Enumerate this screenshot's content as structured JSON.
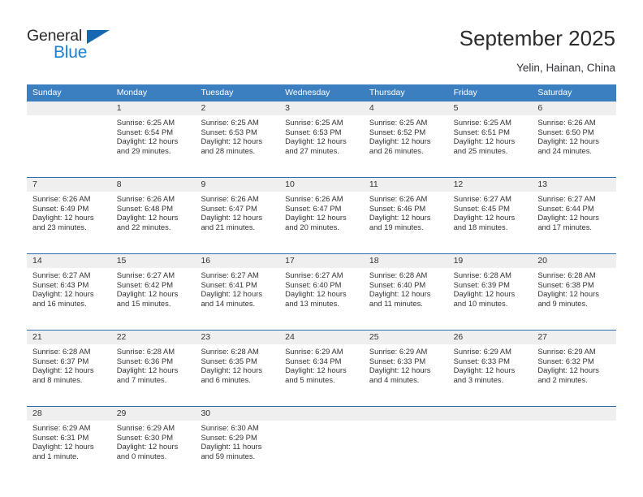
{
  "brand": {
    "name_part1": "General",
    "name_part2": "Blue",
    "triangle_color": "#1667b1",
    "blue_color": "#1f7fd0"
  },
  "header": {
    "title": "September 2025",
    "subtitle": "Yelin, Hainan, China"
  },
  "theme": {
    "header_bg": "#3c7fc1",
    "row_divider": "#2f6daf",
    "daynum_bg": "#efefef",
    "text": "#333333"
  },
  "weekdays": [
    "Sunday",
    "Monday",
    "Tuesday",
    "Wednesday",
    "Thursday",
    "Friday",
    "Saturday"
  ],
  "weeks": [
    [
      {
        "day": "",
        "lines": []
      },
      {
        "day": "1",
        "lines": [
          "Sunrise: 6:25 AM",
          "Sunset: 6:54 PM",
          "Daylight: 12 hours",
          "and 29 minutes."
        ]
      },
      {
        "day": "2",
        "lines": [
          "Sunrise: 6:25 AM",
          "Sunset: 6:53 PM",
          "Daylight: 12 hours",
          "and 28 minutes."
        ]
      },
      {
        "day": "3",
        "lines": [
          "Sunrise: 6:25 AM",
          "Sunset: 6:53 PM",
          "Daylight: 12 hours",
          "and 27 minutes."
        ]
      },
      {
        "day": "4",
        "lines": [
          "Sunrise: 6:25 AM",
          "Sunset: 6:52 PM",
          "Daylight: 12 hours",
          "and 26 minutes."
        ]
      },
      {
        "day": "5",
        "lines": [
          "Sunrise: 6:25 AM",
          "Sunset: 6:51 PM",
          "Daylight: 12 hours",
          "and 25 minutes."
        ]
      },
      {
        "day": "6",
        "lines": [
          "Sunrise: 6:26 AM",
          "Sunset: 6:50 PM",
          "Daylight: 12 hours",
          "and 24 minutes."
        ]
      }
    ],
    [
      {
        "day": "7",
        "lines": [
          "Sunrise: 6:26 AM",
          "Sunset: 6:49 PM",
          "Daylight: 12 hours",
          "and 23 minutes."
        ]
      },
      {
        "day": "8",
        "lines": [
          "Sunrise: 6:26 AM",
          "Sunset: 6:48 PM",
          "Daylight: 12 hours",
          "and 22 minutes."
        ]
      },
      {
        "day": "9",
        "lines": [
          "Sunrise: 6:26 AM",
          "Sunset: 6:47 PM",
          "Daylight: 12 hours",
          "and 21 minutes."
        ]
      },
      {
        "day": "10",
        "lines": [
          "Sunrise: 6:26 AM",
          "Sunset: 6:47 PM",
          "Daylight: 12 hours",
          "and 20 minutes."
        ]
      },
      {
        "day": "11",
        "lines": [
          "Sunrise: 6:26 AM",
          "Sunset: 6:46 PM",
          "Daylight: 12 hours",
          "and 19 minutes."
        ]
      },
      {
        "day": "12",
        "lines": [
          "Sunrise: 6:27 AM",
          "Sunset: 6:45 PM",
          "Daylight: 12 hours",
          "and 18 minutes."
        ]
      },
      {
        "day": "13",
        "lines": [
          "Sunrise: 6:27 AM",
          "Sunset: 6:44 PM",
          "Daylight: 12 hours",
          "and 17 minutes."
        ]
      }
    ],
    [
      {
        "day": "14",
        "lines": [
          "Sunrise: 6:27 AM",
          "Sunset: 6:43 PM",
          "Daylight: 12 hours",
          "and 16 minutes."
        ]
      },
      {
        "day": "15",
        "lines": [
          "Sunrise: 6:27 AM",
          "Sunset: 6:42 PM",
          "Daylight: 12 hours",
          "and 15 minutes."
        ]
      },
      {
        "day": "16",
        "lines": [
          "Sunrise: 6:27 AM",
          "Sunset: 6:41 PM",
          "Daylight: 12 hours",
          "and 14 minutes."
        ]
      },
      {
        "day": "17",
        "lines": [
          "Sunrise: 6:27 AM",
          "Sunset: 6:40 PM",
          "Daylight: 12 hours",
          "and 13 minutes."
        ]
      },
      {
        "day": "18",
        "lines": [
          "Sunrise: 6:28 AM",
          "Sunset: 6:40 PM",
          "Daylight: 12 hours",
          "and 11 minutes."
        ]
      },
      {
        "day": "19",
        "lines": [
          "Sunrise: 6:28 AM",
          "Sunset: 6:39 PM",
          "Daylight: 12 hours",
          "and 10 minutes."
        ]
      },
      {
        "day": "20",
        "lines": [
          "Sunrise: 6:28 AM",
          "Sunset: 6:38 PM",
          "Daylight: 12 hours",
          "and 9 minutes."
        ]
      }
    ],
    [
      {
        "day": "21",
        "lines": [
          "Sunrise: 6:28 AM",
          "Sunset: 6:37 PM",
          "Daylight: 12 hours",
          "and 8 minutes."
        ]
      },
      {
        "day": "22",
        "lines": [
          "Sunrise: 6:28 AM",
          "Sunset: 6:36 PM",
          "Daylight: 12 hours",
          "and 7 minutes."
        ]
      },
      {
        "day": "23",
        "lines": [
          "Sunrise: 6:28 AM",
          "Sunset: 6:35 PM",
          "Daylight: 12 hours",
          "and 6 minutes."
        ]
      },
      {
        "day": "24",
        "lines": [
          "Sunrise: 6:29 AM",
          "Sunset: 6:34 PM",
          "Daylight: 12 hours",
          "and 5 minutes."
        ]
      },
      {
        "day": "25",
        "lines": [
          "Sunrise: 6:29 AM",
          "Sunset: 6:33 PM",
          "Daylight: 12 hours",
          "and 4 minutes."
        ]
      },
      {
        "day": "26",
        "lines": [
          "Sunrise: 6:29 AM",
          "Sunset: 6:33 PM",
          "Daylight: 12 hours",
          "and 3 minutes."
        ]
      },
      {
        "day": "27",
        "lines": [
          "Sunrise: 6:29 AM",
          "Sunset: 6:32 PM",
          "Daylight: 12 hours",
          "and 2 minutes."
        ]
      }
    ],
    [
      {
        "day": "28",
        "lines": [
          "Sunrise: 6:29 AM",
          "Sunset: 6:31 PM",
          "Daylight: 12 hours",
          "and 1 minute."
        ]
      },
      {
        "day": "29",
        "lines": [
          "Sunrise: 6:29 AM",
          "Sunset: 6:30 PM",
          "Daylight: 12 hours",
          "and 0 minutes."
        ]
      },
      {
        "day": "30",
        "lines": [
          "Sunrise: 6:30 AM",
          "Sunset: 6:29 PM",
          "Daylight: 11 hours",
          "and 59 minutes."
        ]
      },
      {
        "day": "",
        "lines": []
      },
      {
        "day": "",
        "lines": []
      },
      {
        "day": "",
        "lines": []
      },
      {
        "day": "",
        "lines": []
      }
    ]
  ]
}
